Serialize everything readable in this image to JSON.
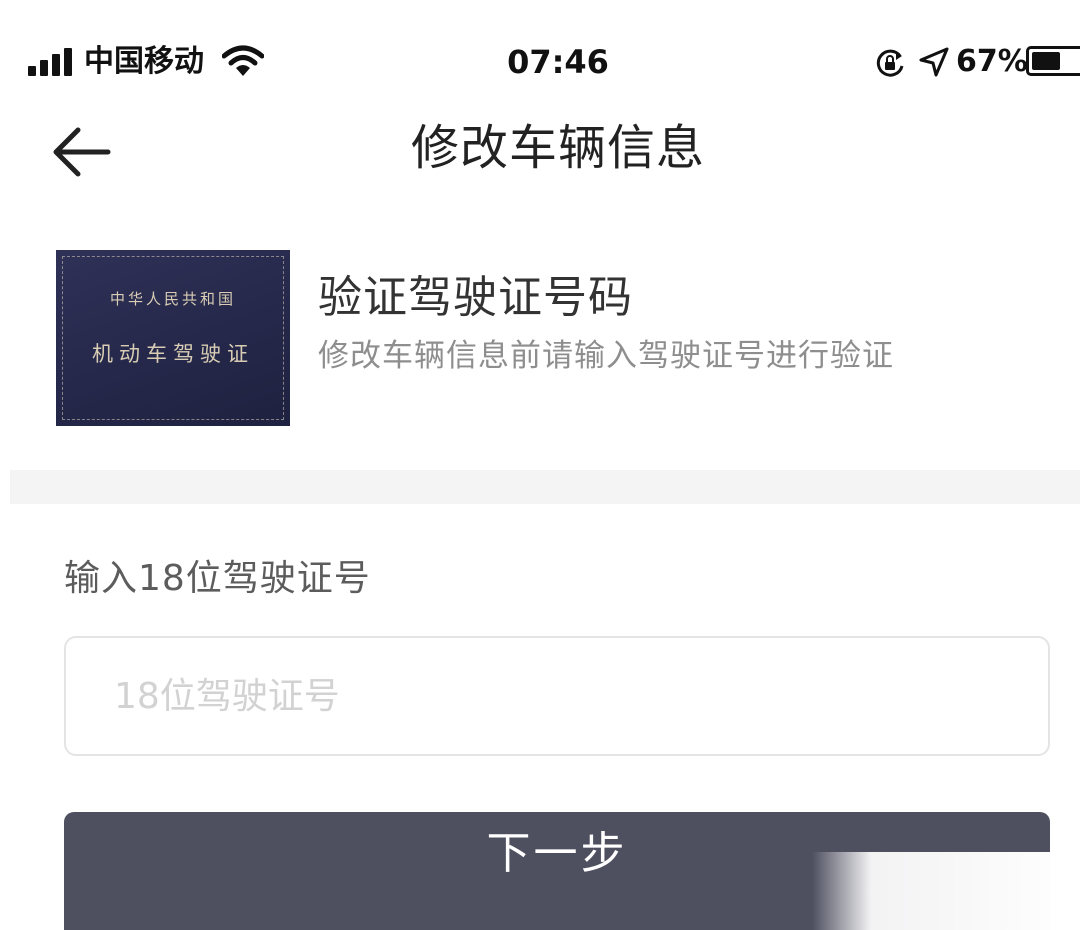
{
  "status_bar": {
    "carrier": "中国移动",
    "time": "07:46",
    "battery_percent": "67%",
    "battery_level": 0.67,
    "icons": [
      "signal-icon",
      "wifi-icon",
      "rotation-lock-icon",
      "location-icon",
      "battery-icon"
    ]
  },
  "nav": {
    "title": "修改车辆信息",
    "back_icon": "arrow-left-icon"
  },
  "verify": {
    "title": "验证驾驶证号码",
    "subtitle": "修改车辆信息前请输入驾驶证号进行验证",
    "license_image": {
      "line1": "中华人民共和国",
      "line2": "机动车驾驶证"
    }
  },
  "form": {
    "label": "输入18位驾驶证号",
    "input_value": "",
    "input_placeholder": "18位驾驶证号",
    "next_label": "下一步"
  },
  "colors": {
    "button_bg": "#4e4f5f",
    "license_bg": "#2f3157",
    "divider": "#f4f4f4",
    "subtitle_text": "#8e8e8e"
  }
}
